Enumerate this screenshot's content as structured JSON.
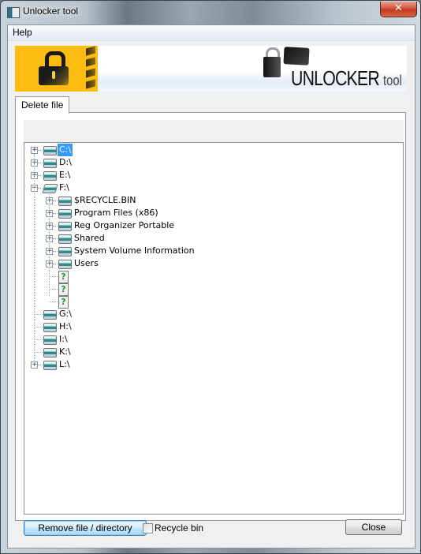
{
  "window": {
    "title": "Unlocker tool",
    "close_glyph": "✕"
  },
  "menu": {
    "items": [
      {
        "label": "Help"
      }
    ]
  },
  "banner": {
    "brand_main": "UNLOCKER",
    "brand_sub": "tool",
    "left_icon": "padlock-icon",
    "right_logo": "unlocker-logo"
  },
  "tabs": [
    {
      "label": "Delete file",
      "active": true
    }
  ],
  "path_bar": {
    "value": ""
  },
  "tree": {
    "nodes": [
      {
        "label": "C:\\",
        "level": 0,
        "type": "drive",
        "expander": "+",
        "selected": true
      },
      {
        "label": "D:\\",
        "level": 0,
        "type": "drive",
        "expander": "+"
      },
      {
        "label": "E:\\",
        "level": 0,
        "type": "drive",
        "expander": "+"
      },
      {
        "label": "F:\\",
        "level": 0,
        "type": "drive-open",
        "expander": "-"
      },
      {
        "label": "$RECYCLE.BIN",
        "level": 1,
        "type": "folder",
        "expander": "+"
      },
      {
        "label": "Program Files (x86)",
        "level": 1,
        "type": "folder",
        "expander": "+"
      },
      {
        "label": "Reg Organizer Portable",
        "level": 1,
        "type": "folder",
        "expander": "+"
      },
      {
        "label": "Shared",
        "level": 1,
        "type": "folder",
        "expander": "+"
      },
      {
        "label": "System Volume Information",
        "level": 1,
        "type": "folder",
        "expander": "+"
      },
      {
        "label": "Users",
        "level": 1,
        "type": "folder",
        "expander": "+"
      },
      {
        "label": "",
        "level": 1,
        "type": "unknown",
        "expander": ""
      },
      {
        "label": "",
        "level": 1,
        "type": "unknown",
        "expander": ""
      },
      {
        "label": "",
        "level": 1,
        "type": "unknown",
        "expander": ""
      },
      {
        "label": "G:\\",
        "level": 0,
        "type": "drive",
        "expander": ""
      },
      {
        "label": "H:\\",
        "level": 0,
        "type": "drive",
        "expander": ""
      },
      {
        "label": "I:\\",
        "level": 0,
        "type": "drive",
        "expander": ""
      },
      {
        "label": "K:\\",
        "level": 0,
        "type": "drive",
        "expander": ""
      },
      {
        "label": "L:\\",
        "level": 0,
        "type": "drive",
        "expander": "+"
      }
    ]
  },
  "footer": {
    "remove_label": "Remove file / directory",
    "recycle_label": "Recycle bin",
    "recycle_checked": false,
    "close_label": "Close"
  },
  "colors": {
    "selection": "#3399ff",
    "banner_yellow": "#fdbd10"
  }
}
